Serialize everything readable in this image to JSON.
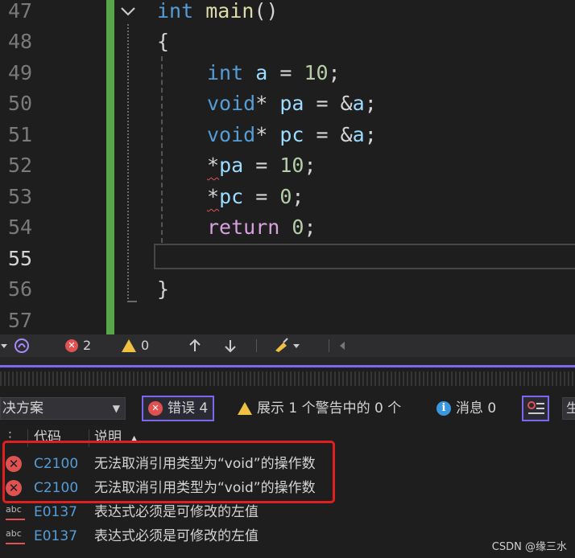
{
  "editor": {
    "line_numbers": [
      "47",
      "48",
      "49",
      "50",
      "51",
      "52",
      "53",
      "54",
      "55",
      "56",
      "57"
    ],
    "active_line": "55",
    "code": {
      "l47": {
        "kw": "int",
        "fn": "main",
        "rest": "()"
      },
      "l48": "{",
      "l49": {
        "kw": "int",
        "var": "a",
        "op": " = ",
        "num": "10",
        "end": ";"
      },
      "l50": {
        "kw": "void",
        "star": "*",
        "var": "pa",
        "op": " = &",
        "var2": "a",
        "end": ";"
      },
      "l51": {
        "kw": "void",
        "star": "*",
        "var": "pc",
        "op": " = &",
        "var2": "a",
        "end": ";"
      },
      "l52": {
        "star": "*",
        "var": "pa",
        "op": " = ",
        "num": "10",
        "end": ";"
      },
      "l53": {
        "star": "*",
        "var": "pc",
        "op": " = ",
        "num": "0",
        "end": ";"
      },
      "l54": {
        "ctl": "return",
        "num": "0",
        "end": ";"
      },
      "l56": "}"
    },
    "colors": {
      "gutter_changed": "#57a64a",
      "keyword": "#569cd6",
      "function": "#dcdcaa",
      "variable": "#9cdcfe",
      "number": "#b5cea8",
      "control": "#d8a0df"
    }
  },
  "statusbar": {
    "error_count": "2",
    "warning_count": "0",
    "icons": [
      "dropdown-arrow-icon",
      "intellicode-icon",
      "error-icon",
      "warning-icon",
      "arrow-up-icon",
      "arrow-down-icon",
      "cleanup-brush-icon",
      "scroll-left-icon"
    ]
  },
  "error_list": {
    "scope_dropdown": "决方案",
    "errors_button": "错误 4",
    "warnings_button": "展示 1 个警告中的 0 个",
    "messages_button": "消息 0",
    "build_dropdown_cut": "生",
    "columns": {
      "code": "代码",
      "description": "说明"
    },
    "rows": [
      {
        "type": "error",
        "code": "C2100",
        "description": "无法取消引用类型为“void”的操作数"
      },
      {
        "type": "error",
        "code": "C2100",
        "description": "无法取消引用类型为“void”的操作数"
      },
      {
        "type": "intellisense",
        "code": "E0137",
        "description": "表达式必须是可修改的左值"
      },
      {
        "type": "intellisense",
        "code": "E0137",
        "description": "表达式必须是可修改的左值"
      }
    ]
  },
  "watermark": "CSDN @缘三水"
}
